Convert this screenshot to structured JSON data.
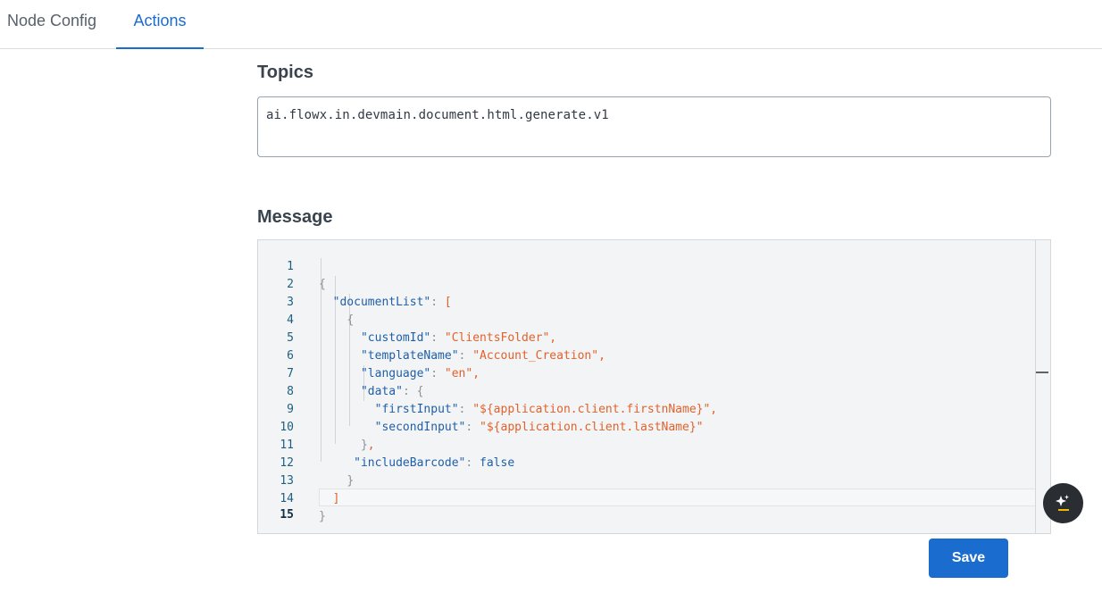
{
  "tabs": [
    {
      "label": "Node Config",
      "active": false
    },
    {
      "label": "Actions",
      "active": true
    }
  ],
  "topics": {
    "title": "Topics",
    "value": "ai.flowx.in.devmain.document.html.generate.v1"
  },
  "message": {
    "title": "Message",
    "line_numbers": [
      "1",
      "2",
      "3",
      "4",
      "5",
      "6",
      "7",
      "8",
      "9",
      "10",
      "11",
      "12",
      "13",
      "14",
      "15"
    ],
    "current_line": "15",
    "code": {
      "l1_open": "{",
      "l2_key": "\"documentList\"",
      "l2_colon": ": ",
      "l2_bracket": "[",
      "l3_open": "{",
      "l4_key": "\"customId\"",
      "l4_colon": ": ",
      "l4_value": "\"ClientsFolder\",",
      "l5_key": "\"templateName\"",
      "l5_colon": ": ",
      "l5_value": "\"Account_Creation\",",
      "l6_key": "\"language\"",
      "l6_colon": ": ",
      "l6_value": "\"en\",",
      "l7_key": "\"data\"",
      "l7_colon": ": ",
      "l7_open": "{",
      "l8_key": "\"firstInput\"",
      "l8_colon": ": ",
      "l8_value": "\"${application.client.firstnName}\",",
      "l9_key": "\"secondInput\"",
      "l9_colon": ": ",
      "l9_value": "\"${application.client.lastName}\"",
      "l10_close": "}",
      "l10_comma": ",",
      "l11_key": "\"includeBarcode\"",
      "l11_colon": ": ",
      "l11_value": "false",
      "l12_close": "}",
      "l13_bracket": "]",
      "l14_close": "}"
    }
  },
  "actions": {
    "save_label": "Save"
  },
  "colors": {
    "accent": "#1a6ccf",
    "string": "#e0622c",
    "key": "#1f5fa8"
  },
  "icons": {
    "ai_assistant": "sparkle-icon"
  }
}
